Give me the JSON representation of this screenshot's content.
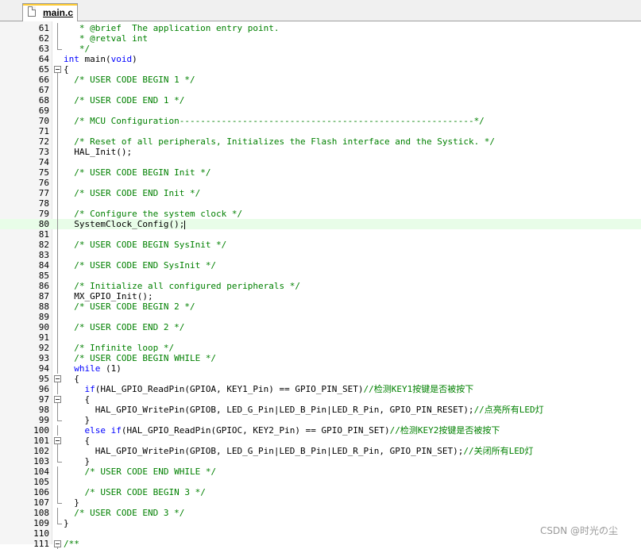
{
  "tab": {
    "label": "main.c",
    "icon": "c-file-icon"
  },
  "watermark": "CSDN @时光の尘",
  "colors": {
    "keyword": "#0000ff",
    "comment": "#008000",
    "current_line": "#e8fde8",
    "tab_accent": "#ffcc33"
  },
  "current_line": 80,
  "lines": [
    {
      "n": "61",
      "fold": "bar",
      "seg": [
        {
          "t": "   * @brief  The application entry point.",
          "c": "cm"
        }
      ]
    },
    {
      "n": "62",
      "fold": "bar",
      "seg": [
        {
          "t": "   * @retval int",
          "c": "cm"
        }
      ]
    },
    {
      "n": "63",
      "fold": "end",
      "seg": [
        {
          "t": "   */",
          "c": "cm"
        }
      ]
    },
    {
      "n": "64",
      "fold": "",
      "seg": [
        {
          "t": "int",
          "c": "kw"
        },
        {
          "t": " main("
        },
        {
          "t": "void",
          "c": "kw"
        },
        {
          "t": ")"
        }
      ]
    },
    {
      "n": "65",
      "fold": "box",
      "seg": [
        {
          "t": "{"
        }
      ]
    },
    {
      "n": "66",
      "fold": "bar",
      "seg": [
        {
          "t": "  "
        },
        {
          "t": "/* USER CODE BEGIN 1 */",
          "c": "cm"
        }
      ]
    },
    {
      "n": "67",
      "fold": "bar",
      "seg": []
    },
    {
      "n": "68",
      "fold": "bar",
      "seg": [
        {
          "t": "  "
        },
        {
          "t": "/* USER CODE END 1 */",
          "c": "cm"
        }
      ]
    },
    {
      "n": "69",
      "fold": "bar",
      "seg": []
    },
    {
      "n": "70",
      "fold": "bar",
      "seg": [
        {
          "t": "  "
        },
        {
          "t": "/* MCU Configuration--------------------------------------------------------*/",
          "c": "cm"
        }
      ]
    },
    {
      "n": "71",
      "fold": "bar",
      "seg": []
    },
    {
      "n": "72",
      "fold": "bar",
      "seg": [
        {
          "t": "  "
        },
        {
          "t": "/* Reset of all peripherals, Initializes the Flash interface and the Systick. */",
          "c": "cm"
        }
      ]
    },
    {
      "n": "73",
      "fold": "bar",
      "seg": [
        {
          "t": "  HAL_Init();"
        }
      ]
    },
    {
      "n": "74",
      "fold": "bar",
      "seg": []
    },
    {
      "n": "75",
      "fold": "bar",
      "seg": [
        {
          "t": "  "
        },
        {
          "t": "/* USER CODE BEGIN Init */",
          "c": "cm"
        }
      ]
    },
    {
      "n": "76",
      "fold": "bar",
      "seg": []
    },
    {
      "n": "77",
      "fold": "bar",
      "seg": [
        {
          "t": "  "
        },
        {
          "t": "/* USER CODE END Init */",
          "c": "cm"
        }
      ]
    },
    {
      "n": "78",
      "fold": "bar",
      "seg": []
    },
    {
      "n": "79",
      "fold": "bar",
      "seg": [
        {
          "t": "  "
        },
        {
          "t": "/* Configure the system clock */",
          "c": "cm"
        }
      ]
    },
    {
      "n": "80",
      "fold": "bar",
      "seg": [
        {
          "t": "  SystemClock_Config();"
        }
      ]
    },
    {
      "n": "81",
      "fold": "bar",
      "seg": []
    },
    {
      "n": "82",
      "fold": "bar",
      "seg": [
        {
          "t": "  "
        },
        {
          "t": "/* USER CODE BEGIN SysInit */",
          "c": "cm"
        }
      ]
    },
    {
      "n": "83",
      "fold": "bar",
      "seg": []
    },
    {
      "n": "84",
      "fold": "bar",
      "seg": [
        {
          "t": "  "
        },
        {
          "t": "/* USER CODE END SysInit */",
          "c": "cm"
        }
      ]
    },
    {
      "n": "85",
      "fold": "bar",
      "seg": []
    },
    {
      "n": "86",
      "fold": "bar",
      "seg": [
        {
          "t": "  "
        },
        {
          "t": "/* Initialize all configured peripherals */",
          "c": "cm"
        }
      ]
    },
    {
      "n": "87",
      "fold": "bar",
      "seg": [
        {
          "t": "  MX_GPIO_Init();"
        }
      ]
    },
    {
      "n": "88",
      "fold": "bar",
      "seg": [
        {
          "t": "  "
        },
        {
          "t": "/* USER CODE BEGIN 2 */",
          "c": "cm"
        }
      ]
    },
    {
      "n": "89",
      "fold": "bar",
      "seg": []
    },
    {
      "n": "90",
      "fold": "bar",
      "seg": [
        {
          "t": "  "
        },
        {
          "t": "/* USER CODE END 2 */",
          "c": "cm"
        }
      ]
    },
    {
      "n": "91",
      "fold": "bar",
      "seg": []
    },
    {
      "n": "92",
      "fold": "bar",
      "seg": [
        {
          "t": "  "
        },
        {
          "t": "/* Infinite loop */",
          "c": "cm"
        }
      ]
    },
    {
      "n": "93",
      "fold": "bar",
      "seg": [
        {
          "t": "  "
        },
        {
          "t": "/* USER CODE BEGIN WHILE */",
          "c": "cm"
        }
      ]
    },
    {
      "n": "94",
      "fold": "bar",
      "seg": [
        {
          "t": "  "
        },
        {
          "t": "while",
          "c": "kw"
        },
        {
          "t": " (1)"
        }
      ]
    },
    {
      "n": "95",
      "fold": "box",
      "seg": [
        {
          "t": "  {"
        }
      ]
    },
    {
      "n": "96",
      "fold": "bar",
      "seg": [
        {
          "t": "    "
        },
        {
          "t": "if",
          "c": "kw"
        },
        {
          "t": "(HAL_GPIO_ReadPin(GPIOA, KEY1_Pin) == GPIO_PIN_SET)"
        },
        {
          "t": "//检测KEY1按键是否被按下",
          "c": "cm"
        }
      ]
    },
    {
      "n": "97",
      "fold": "box",
      "seg": [
        {
          "t": "    {"
        }
      ]
    },
    {
      "n": "98",
      "fold": "bar",
      "seg": [
        {
          "t": "      HAL_GPIO_WritePin(GPIOB, LED_G_Pin|LED_B_Pin|LED_R_Pin, GPIO_PIN_RESET);"
        },
        {
          "t": "//点亮所有LED灯",
          "c": "cm"
        }
      ]
    },
    {
      "n": "99",
      "fold": "end",
      "seg": [
        {
          "t": "    }"
        }
      ]
    },
    {
      "n": "100",
      "fold": "bar",
      "seg": [
        {
          "t": "    "
        },
        {
          "t": "else if",
          "c": "kw"
        },
        {
          "t": "(HAL_GPIO_ReadPin(GPIOC, KEY2_Pin) == GPIO_PIN_SET)"
        },
        {
          "t": "//检测KEY2按键是否被按下",
          "c": "cm"
        }
      ]
    },
    {
      "n": "101",
      "fold": "box",
      "seg": [
        {
          "t": "    {"
        }
      ]
    },
    {
      "n": "102",
      "fold": "bar",
      "seg": [
        {
          "t": "      HAL_GPIO_WritePin(GPIOB, LED_G_Pin|LED_B_Pin|LED_R_Pin, GPIO_PIN_SET);"
        },
        {
          "t": "//关闭所有LED灯",
          "c": "cm"
        }
      ]
    },
    {
      "n": "103",
      "fold": "end",
      "seg": [
        {
          "t": "    }"
        }
      ]
    },
    {
      "n": "104",
      "fold": "bar",
      "seg": [
        {
          "t": "    "
        },
        {
          "t": "/* USER CODE END WHILE */",
          "c": "cm"
        }
      ]
    },
    {
      "n": "105",
      "fold": "bar",
      "seg": []
    },
    {
      "n": "106",
      "fold": "bar",
      "seg": [
        {
          "t": "    "
        },
        {
          "t": "/* USER CODE BEGIN 3 */",
          "c": "cm"
        }
      ]
    },
    {
      "n": "107",
      "fold": "end",
      "seg": [
        {
          "t": "  }"
        }
      ]
    },
    {
      "n": "108",
      "fold": "bar",
      "seg": [
        {
          "t": "  "
        },
        {
          "t": "/* USER CODE END 3 */",
          "c": "cm"
        }
      ]
    },
    {
      "n": "109",
      "fold": "end",
      "seg": [
        {
          "t": "}"
        }
      ]
    },
    {
      "n": "110",
      "fold": "",
      "seg": []
    },
    {
      "n": "111",
      "fold": "box",
      "seg": [
        {
          "t": "/**",
          "c": "cm"
        }
      ]
    }
  ]
}
